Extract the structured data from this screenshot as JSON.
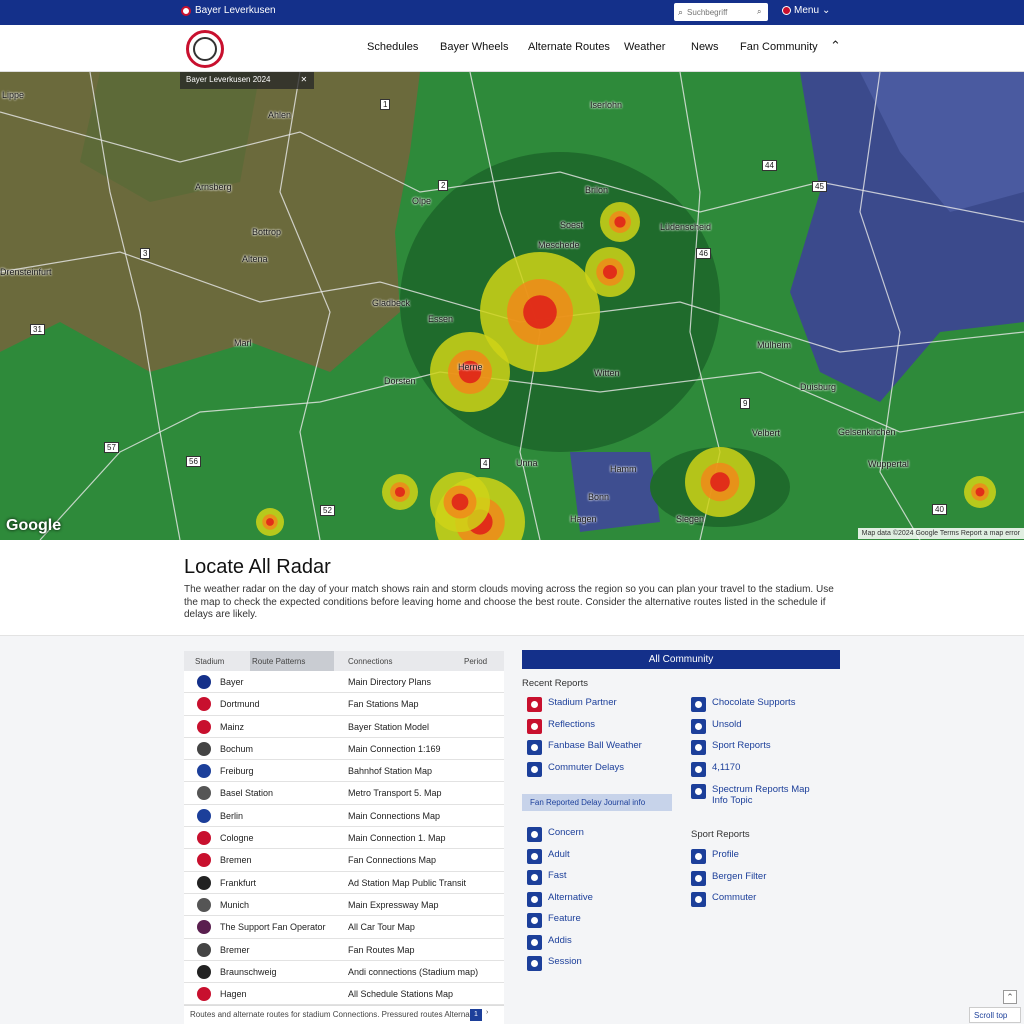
{
  "top_bar": {
    "brand": "Bayer Leverkusen",
    "search_placeholder": "Suchbegriff",
    "language": "Menu"
  },
  "nav": {
    "links": [
      "Schedules",
      "Bayer Wheels",
      "Alternate Routes",
      "Weather",
      "News",
      "Fan Community"
    ]
  },
  "map": {
    "info_label": "Bayer Leverkusen 2024",
    "google_label": "Google",
    "attribution": "Map data ©2024 Google  Terms  Report a map error",
    "labels": [
      "Lippe",
      "Ahlen",
      "Arnsberg",
      "Drensteinfurt",
      "Altena",
      "Marl",
      "Bottrop",
      "Essen",
      "Dorsten",
      "Gladbeck",
      "Herne",
      "Witten",
      "Unna",
      "Hamm",
      "Soest",
      "Iserlohn",
      "Hagen",
      "Mülheim",
      "Duisburg",
      "Gelsenkirchen",
      "Velbert",
      "Wuppertal",
      "Bonn",
      "Siegen",
      "Olpe",
      "Brilon",
      "Meschede",
      "Lüdenscheid"
    ],
    "route_signs": [
      "1",
      "2",
      "44",
      "45",
      "46",
      "3",
      "31",
      "52",
      "40",
      "9",
      "4",
      "56",
      "57"
    ]
  },
  "intro": {
    "title": "Locate All Radar",
    "text": "The weather radar on the day of your match shows rain and storm clouds moving across the region so you can plan your travel to the stadium. Use the map to check the expected conditions before leaving home and choose the best route. Consider the alternative routes listed in the schedule if delays are likely."
  },
  "table": {
    "headers": [
      "Stadium",
      "Route Patterns",
      "Connections",
      "Period"
    ],
    "rows": [
      {
        "name": "Bayer",
        "desc": "Main Directory Plans",
        "color": "#14308a"
      },
      {
        "name": "Dortmund",
        "desc": "Fan Stations Map",
        "color": "#c8102e"
      },
      {
        "name": "Mainz",
        "desc": "Bayer Station Model",
        "color": "#c8102e"
      },
      {
        "name": "Bochum",
        "desc": "Main Connection 1:169",
        "color": "#444"
      },
      {
        "name": "Freiburg",
        "desc": "Bahnhof Station Map",
        "color": "#1c3f9a"
      },
      {
        "name": "Basel Station",
        "desc": "Metro Transport 5. Map",
        "color": "#555"
      },
      {
        "name": "Berlin",
        "desc": "Main Connections Map",
        "color": "#1c3f9a"
      },
      {
        "name": "Cologne",
        "desc": "Main Connection 1. Map",
        "color": "#c8102e"
      },
      {
        "name": "Bremen",
        "desc": "Fan Connections Map",
        "color": "#c8102e"
      },
      {
        "name": "Frankfurt",
        "desc": "Ad Station Map Public Transit",
        "color": "#222"
      },
      {
        "name": "Munich",
        "desc": "Main Expressway Map",
        "color": "#555"
      },
      {
        "name": "The Support Fan Operator",
        "desc": "All Car Tour Map",
        "color": "#5a1f4f"
      },
      {
        "name": "Bremer",
        "desc": "Fan Routes Map",
        "color": "#444"
      },
      {
        "name": "Braunschweig",
        "desc": "Andi connections (Stadium map)",
        "color": "#222"
      },
      {
        "name": "Hagen",
        "desc": "All Schedule Stations Map",
        "color": "#c8102e"
      }
    ],
    "footer": "Routes and alternate routes for stadium Connections. Pressured routes Alternative",
    "page": "1",
    "next": "›"
  },
  "community": {
    "header": "All Community",
    "section1_title": "Recent Reports",
    "left_links": [
      {
        "label": "Stadium Partner",
        "color": "#c8102e"
      },
      {
        "label": "Reflections",
        "color": "#c8102e"
      },
      {
        "label": "Fanbase Ball Weather",
        "color": "#1c3f9a"
      },
      {
        "label": "Commuter Delays",
        "color": "#1c3f9a"
      }
    ],
    "right_links": [
      {
        "label": "Chocolate Supports",
        "color": "#1c3f9a"
      },
      {
        "label": "Unsold",
        "color": "#1c3f9a"
      },
      {
        "label": "Sport Reports",
        "color": "#1c3f9a"
      },
      {
        "label": "4,1170",
        "color": "#1c3f9a"
      },
      {
        "label": "Spectrum Reports Map Info Topic",
        "color": "#1c3f9a"
      }
    ],
    "banner": "Fan Reported Delay Journal info",
    "section2_title": "Sport Reports",
    "left_links2": [
      {
        "label": "Concern",
        "color": "#1c3f9a"
      },
      {
        "label": "Adult",
        "color": "#1c3f9a"
      },
      {
        "label": "Fast",
        "color": "#1c3f9a"
      },
      {
        "label": "Alternative",
        "color": "#1c3f9a"
      },
      {
        "label": "Feature",
        "color": "#1c3f9a"
      },
      {
        "label": "Addis",
        "color": "#1c3f9a"
      },
      {
        "label": "Session",
        "color": "#1c3f9a"
      }
    ],
    "right_links2": [
      {
        "label": "Profile",
        "color": "#1c3f9a"
      },
      {
        "label": "Bergen Filter",
        "color": "#1c3f9a"
      },
      {
        "label": "Commuter",
        "color": "#1c3f9a"
      }
    ]
  },
  "corner_tag": "Scroll top",
  "scroll_up_glyph": "⌃"
}
